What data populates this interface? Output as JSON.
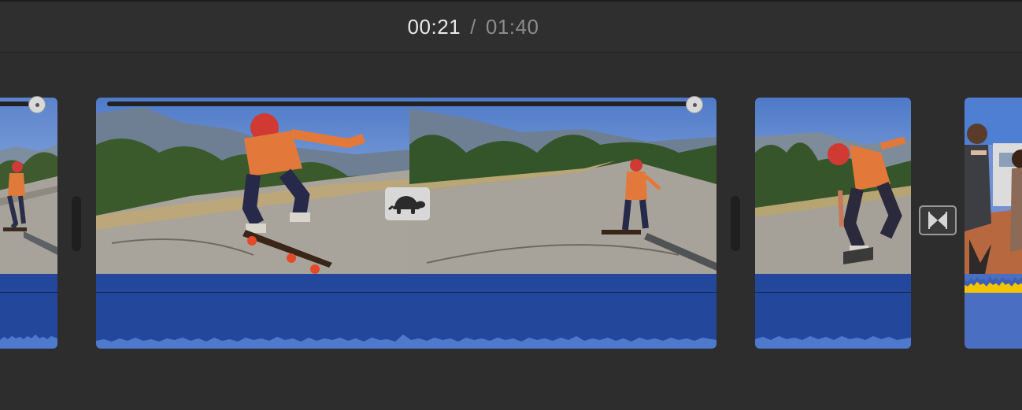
{
  "playhead": {
    "current_time": "00:21",
    "separator": "/",
    "total_duration": "01:40"
  },
  "timeline": {
    "clips": [
      {
        "name": "skateboard-clip-left",
        "has_audio": true
      },
      {
        "name": "skateboard-clip-slowmo",
        "speed": "slow",
        "speed_icon": "turtle-icon",
        "has_audio": true
      },
      {
        "name": "skateboard-clip-right",
        "has_audio": true
      },
      {
        "name": "friends-clip",
        "has_audio": true
      }
    ],
    "transition_icon": "cross-dissolve-icon"
  },
  "colors": {
    "background": "#2d2d2d",
    "audio_waveform": "#22479b",
    "audio_peak": "#4f79cc",
    "audio_highlight": "#f5c400"
  }
}
